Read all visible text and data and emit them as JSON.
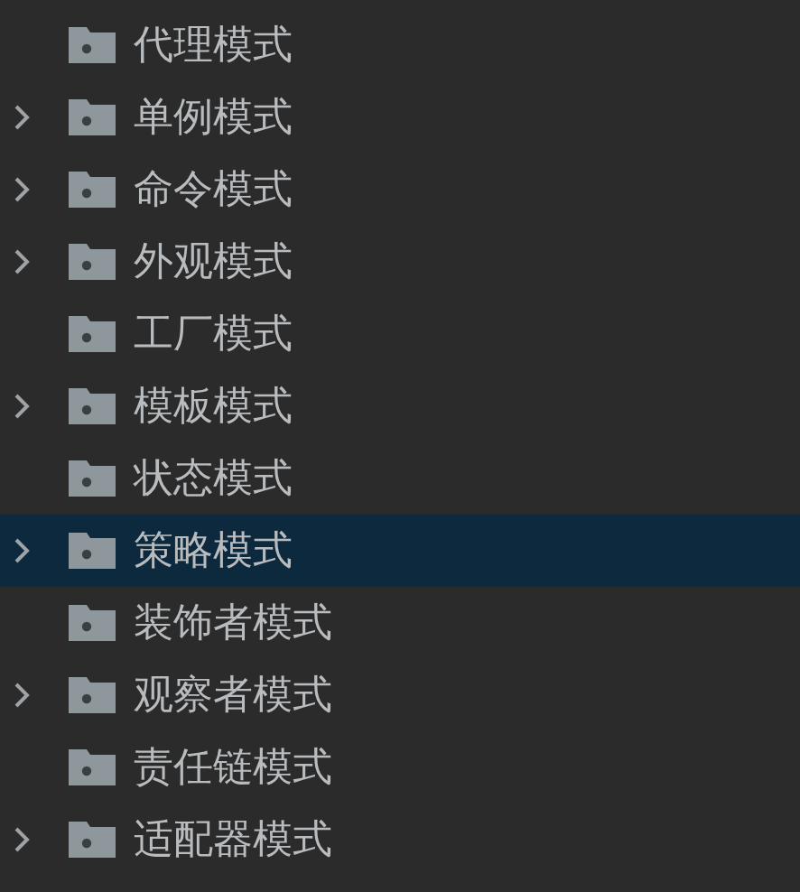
{
  "tree": {
    "items": [
      {
        "label": "代理模式",
        "expandable": false,
        "selected": false
      },
      {
        "label": "单例模式",
        "expandable": true,
        "selected": false
      },
      {
        "label": "命令模式",
        "expandable": true,
        "selected": false
      },
      {
        "label": "外观模式",
        "expandable": true,
        "selected": false
      },
      {
        "label": "工厂模式",
        "expandable": false,
        "selected": false
      },
      {
        "label": "模板模式",
        "expandable": true,
        "selected": false
      },
      {
        "label": "状态模式",
        "expandable": false,
        "selected": false
      },
      {
        "label": "策略模式",
        "expandable": true,
        "selected": true
      },
      {
        "label": "装饰者模式",
        "expandable": false,
        "selected": false
      },
      {
        "label": "观察者模式",
        "expandable": true,
        "selected": false
      },
      {
        "label": "责任链模式",
        "expandable": false,
        "selected": false
      },
      {
        "label": "适配器模式",
        "expandable": true,
        "selected": false
      }
    ]
  }
}
